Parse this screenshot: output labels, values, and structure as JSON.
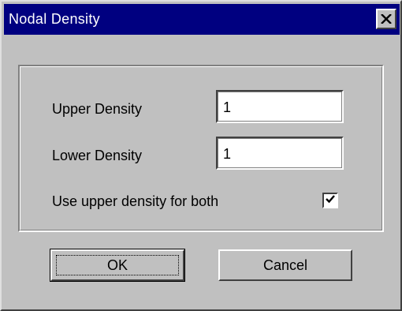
{
  "window": {
    "title": "Nodal Density",
    "close_icon": "close-icon"
  },
  "form": {
    "upper_density_label": "Upper Density",
    "upper_density_value": "1",
    "lower_density_label": "Lower Density",
    "lower_density_value": "1",
    "use_upper_label": "Use upper density for both",
    "use_upper_checked": true
  },
  "buttons": {
    "ok_label": "OK",
    "cancel_label": "Cancel"
  },
  "colors": {
    "titlebar": "#000080",
    "face": "#c0c0c0"
  }
}
